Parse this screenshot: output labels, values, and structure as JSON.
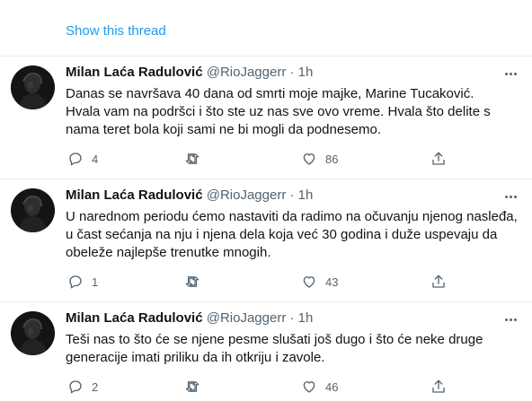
{
  "show_thread": "Show this thread",
  "tweets": [
    {
      "name": "Milan Laća Radulović",
      "handle": "@RioJaggerr",
      "dot": "·",
      "time": "1h",
      "text": "Danas se navršava 40 dana od smrti moje majke, Marine Tucaković.\nHvala vam na podršci i što ste uz nas sve ovo vreme. Hvala što delite s\nnama teret bola koji sami ne bi mogli da podnesemo.",
      "replies": "4",
      "retweets": "",
      "likes": "86"
    },
    {
      "name": "Milan Laća Radulović",
      "handle": "@RioJaggerr",
      "dot": "·",
      "time": "1h",
      "text": "U narednom periodu ćemo nastaviti da radimo na očuvanju njenog nasleđa,\nu čast sećanja na nju i njena dela koja već 30 godina i duže uspevaju da\nobeleže najlepše trenutke mnogih.",
      "replies": "1",
      "retweets": "",
      "likes": "43"
    },
    {
      "name": "Milan Laća Radulović",
      "handle": "@RioJaggerr",
      "dot": "·",
      "time": "1h",
      "text": "Teši nas to što će se njene pesme slušati još dugo i što će neke druge\ngeneracije imati priliku da ih otkriju i zavole.",
      "replies": "2",
      "retweets": "",
      "likes": "46"
    }
  ],
  "icons": {
    "reply": "reply-icon",
    "retweet": "retweet-icon",
    "like": "heart-icon",
    "share": "share-icon",
    "more": "more-icon"
  },
  "colors": {
    "accent": "#1d9bf0",
    "secondary_text": "#536471",
    "divider": "#e6ecf0"
  }
}
